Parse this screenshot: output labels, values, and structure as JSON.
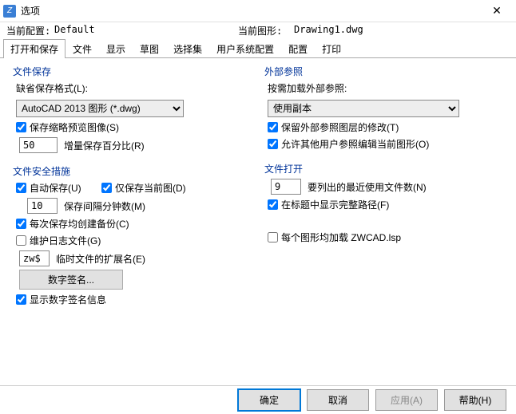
{
  "window": {
    "title": "选项"
  },
  "profile": {
    "current_label": "当前配置:",
    "current_value": "Default",
    "drawing_label": "当前图形:",
    "drawing_value": "Drawing1.dwg"
  },
  "tabs": [
    "打开和保存",
    "文件",
    "显示",
    "草图",
    "选择集",
    "用户系统配置",
    "配置",
    "打印"
  ],
  "file_save": {
    "title": "文件保存",
    "format_label": "缺省保存格式(L):",
    "format_value": "AutoCAD 2013 图形 (*.dwg)",
    "thumbnail_label": "保存缩略预览图像(S)",
    "increment_value": "50",
    "increment_label": "增量保存百分比(R)"
  },
  "file_safety": {
    "title": "文件安全措施",
    "autosave_label": "自动保存(U)",
    "onlycurrent_label": "仅保存当前图(D)",
    "interval_value": "10",
    "interval_label": "保存间隔分钟数(M)",
    "backup_label": "每次保存均创建备份(C)",
    "log_label": "维护日志文件(G)",
    "tmpext_value": "zw$",
    "tmpext_label": "临时文件的扩展名(E)",
    "sig_button": "数字签名...",
    "showsig_label": "显示数字签名信息"
  },
  "xref": {
    "title": "外部参照",
    "load_label": "按需加载外部参照:",
    "load_value": "使用副本",
    "keeplayer_label": "保留外部参照图层的修改(T)",
    "allowedit_label": "允许其他用户参照编辑当前图形(O)"
  },
  "file_open": {
    "title": "文件打开",
    "recent_value": "9",
    "recent_label": "要列出的最近使用文件数(N)",
    "fullpath_label": "在标题中显示完整路径(F)"
  },
  "misc": {
    "lsp_label": "每个图形均加载 ZWCAD.lsp"
  },
  "footer": {
    "ok": "确定",
    "cancel": "取消",
    "apply": "应用(A)",
    "help": "帮助(H)"
  }
}
